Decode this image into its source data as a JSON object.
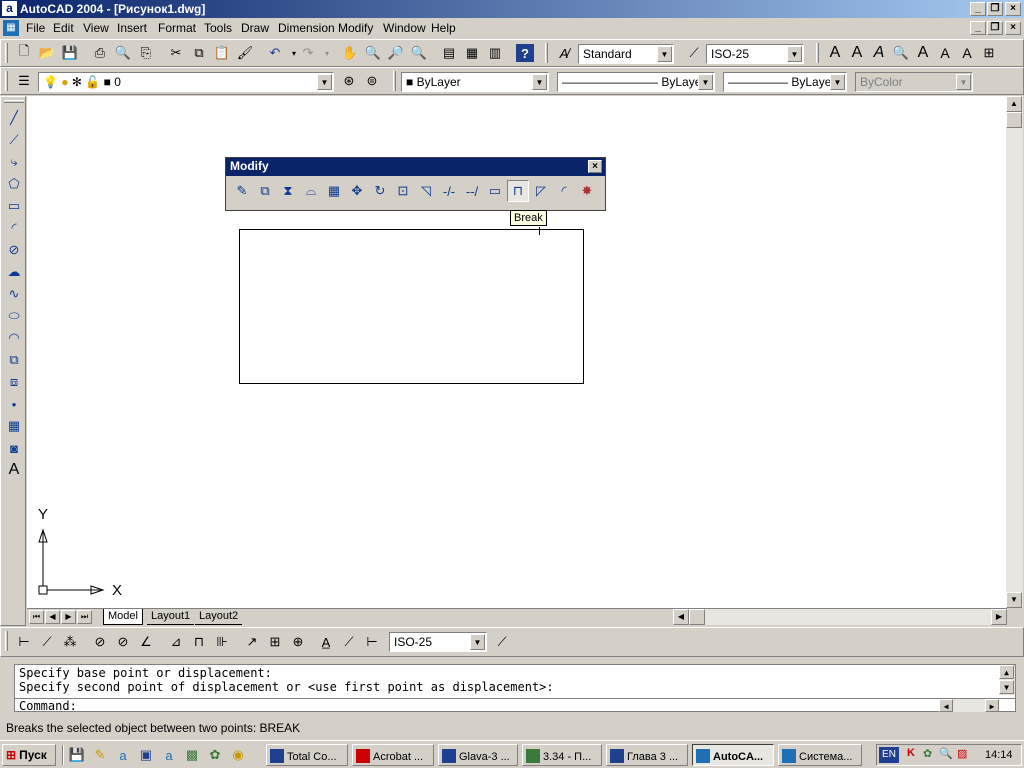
{
  "window": {
    "title": "AutoCAD 2004 - [Рисунок1.dwg]",
    "app_icon": "a",
    "caption_buttons": [
      "_",
      "❐",
      "×"
    ]
  },
  "menu": {
    "items": [
      "File",
      "Edit",
      "View",
      "Insert",
      "Format",
      "Tools",
      "Draw",
      "Dimension",
      "Modify",
      "Window",
      "Help"
    ]
  },
  "styles_toolbar": {
    "text_style": "Standard",
    "dim_style": "ISO-25"
  },
  "layers_toolbar": {
    "layer": "0",
    "color": "ByLayer",
    "linetype": "ByLayer",
    "lineweight": "ByLayer",
    "plotstyle": "ByColor"
  },
  "modify_toolbar": {
    "title": "Modify",
    "close": "×",
    "tooltip": "Break"
  },
  "ucs": {
    "x_label": "X",
    "y_label": "Y"
  },
  "tabs": {
    "model": "Model",
    "layout1": "Layout1",
    "layout2": "Layout2"
  },
  "dimension_toolbar": {
    "dim_style": "ISO-25"
  },
  "command": {
    "line1": "Specify base point or displacement:",
    "line2": "Specify second point of displacement or <use first point as displacement>:",
    "prompt": "Command:"
  },
  "status": {
    "text": "Breaks the selected object between two points:  BREAK"
  },
  "taskbar": {
    "start": "Пуск",
    "tasks": [
      "Total Co...",
      "Acrobat ...",
      "Glava-3 ...",
      "3.34 - П...",
      "Глава 3 ...",
      "AutoCA...",
      "Система..."
    ],
    "lang": "EN",
    "clock": "14:14"
  },
  "colors": {
    "title_active": "#0a246a",
    "face": "#d4d0c8",
    "canvas": "#ffffff",
    "tooltip": "#ffffe1"
  }
}
